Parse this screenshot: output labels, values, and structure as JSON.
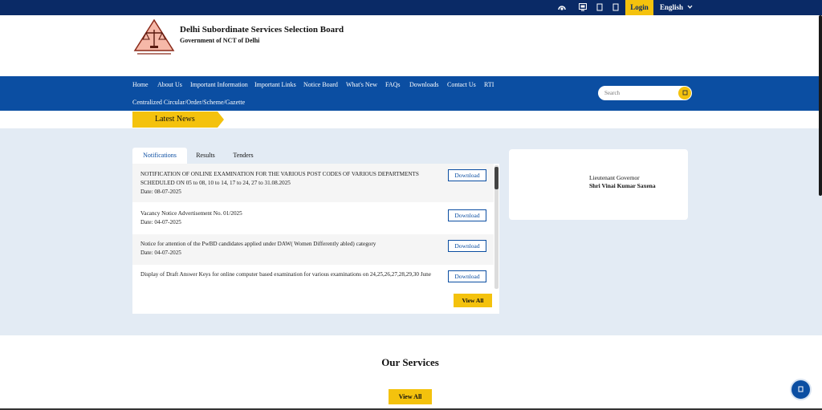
{
  "topbar": {
    "icons": [
      "accessibility-icon",
      "sitemap-icon",
      "screen-reader-icon",
      "text-size-icon"
    ],
    "login_label": "Login",
    "language_label": "English",
    "language_chevron": "⌄"
  },
  "header": {
    "org_name": "Delhi Subordinate Services Selection Board",
    "org_sub": "Government of NCT of Delhi"
  },
  "nav": {
    "items": [
      "Home",
      "About Us",
      "Important Information",
      "Important Links",
      "Notice Board",
      "What's New",
      "FAQs",
      "Downloads",
      "Contact Us",
      "RTI",
      "Centralized Circular/Order/Scheme/Gazette"
    ],
    "search_placeholder": "Search"
  },
  "latest_news": {
    "label": "Latest News"
  },
  "tabs": [
    "Notifications",
    "Results",
    "Tenders"
  ],
  "notifications": [
    {
      "title": "NOTIFICATION OF ONLINE EXAMINATION FOR THE VARIOUS POST CODES OF VARIOUS DEPARTMENTS SCHEDULED ON 05 to 08, 10 to 14, 17 to 24, 27 to 31.08.2025",
      "date": "Date: 08-07-2025",
      "button": "Download"
    },
    {
      "title": "Vacancy Notice Advertisement No. 01/2025",
      "date": "Date: 04-07-2025",
      "button": "Download"
    },
    {
      "title": "Notice for attention of the PwBD candidates applied under DAW( Women Differently abled) category",
      "date": "Date: 04-07-2025",
      "button": "Download"
    },
    {
      "title": "Display of Draft Answer Keys for online computer based examination for various examinations on 24,25,26,27,28,29,30 June",
      "date": "",
      "button": "Download"
    }
  ],
  "view_all_label": "View All",
  "governor": {
    "title": "Lieutenant Governor",
    "name": "Shri Vinai Kumar Saxena"
  },
  "services": {
    "title": "Our Services",
    "view_all_label": "View All"
  },
  "colors": {
    "navy": "#0a2a66",
    "blue": "#0b4ea2",
    "yellow": "#f4c20d",
    "band": "#e3ebf4"
  }
}
